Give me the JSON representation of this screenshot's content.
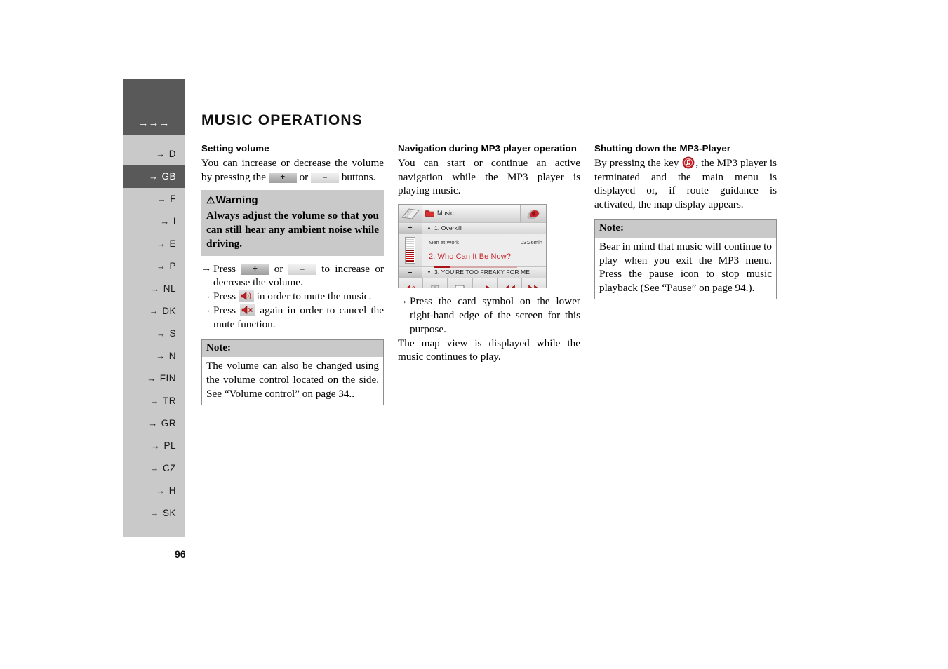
{
  "header": {
    "arrows": "→→→",
    "title": "MUSIC OPERATIONS"
  },
  "sidebar": {
    "items": [
      {
        "label": "D",
        "active": false
      },
      {
        "label": "GB",
        "active": true
      },
      {
        "label": "F",
        "active": false
      },
      {
        "label": "I",
        "active": false
      },
      {
        "label": "E",
        "active": false
      },
      {
        "label": "P",
        "active": false
      },
      {
        "label": "NL",
        "active": false
      },
      {
        "label": "DK",
        "active": false
      },
      {
        "label": "S",
        "active": false
      },
      {
        "label": "N",
        "active": false
      },
      {
        "label": "FIN",
        "active": false
      },
      {
        "label": "TR",
        "active": false
      },
      {
        "label": "GR",
        "active": false
      },
      {
        "label": "PL",
        "active": false
      },
      {
        "label": "CZ",
        "active": false
      },
      {
        "label": "H",
        "active": false
      },
      {
        "label": "SK",
        "active": false
      }
    ]
  },
  "column1": {
    "heading": "Setting volume",
    "intro_a": "You can increase or decrease the volume by pressing the ",
    "key_plus": "+",
    "intro_b": " or ",
    "key_minus": "–",
    "intro_c": " buttons.",
    "warning": {
      "triangle": "⚠",
      "title": "Warning",
      "body": "Always adjust the volume so that you can still hear any ambient noise while driving."
    },
    "steps": [
      {
        "arrow": "→",
        "pre": "Press ",
        "post": " to increase or decrease the volume.",
        "mid": " or "
      },
      {
        "arrow": "→",
        "text_a": "Press ",
        "text_b": " in order to mute the music."
      },
      {
        "arrow": "→",
        "text_a": "Press ",
        "text_b": " again in order to cancel the mute function."
      }
    ],
    "note": {
      "head": "Note:",
      "body": "The volume can also be changed using the volume control located on the side. See “Volume control” on page 34.."
    }
  },
  "column2": {
    "heading": "Navigation during MP3 player operation",
    "intro": "You can start or continue an active navigation while the MP3 player is playing music.",
    "player": {
      "book_icon": "book-icon",
      "folder_label": "Music",
      "card_icon": "card-map-icon",
      "plus_key": "+",
      "minus_key": "–",
      "prev_arrow": "▲",
      "prev_track": "1. Overkill",
      "next_arrow": "▼",
      "next_track": "3. YOU'RE TOO FREAKY FOR ME",
      "artist": "Men at Work",
      "duration": "03:26min",
      "current_track": "2. Who Can It Be Now?",
      "progress_percent": 19,
      "volume_filled_bars": 6,
      "volume_total_bars": 11,
      "controls": [
        "mute-icon",
        "pause-icon",
        "stop-icon",
        "arrow-right-icon",
        "rewind-icon",
        "fast-forward-icon"
      ]
    },
    "step": {
      "arrow": "→",
      "text": "Press the card symbol on the lower right-hand edge of the screen for this purpose."
    },
    "outro": "The map view is displayed while the music continues to play."
  },
  "column3": {
    "heading": "Shutting down the MP3-Player",
    "text_a": "By pressing the key ",
    "key_icon": "mp3-key-icon",
    "text_b": ", the MP3 player is terminated and the main menu is displayed or, if route guidance is activated, the map display appears.",
    "note": {
      "head": "Note:",
      "body": "Bear in mind that music will continue to play when you exit the MP3 menu. Press the pause icon to stop music playback (See “Pause” on page 94.)."
    }
  },
  "footer": {
    "page_number": "96"
  },
  "colors": {
    "tab_active": "#595959",
    "tab_inactive": "#c9c9c9",
    "accent_red": "#c2282c",
    "text": "#000000"
  }
}
